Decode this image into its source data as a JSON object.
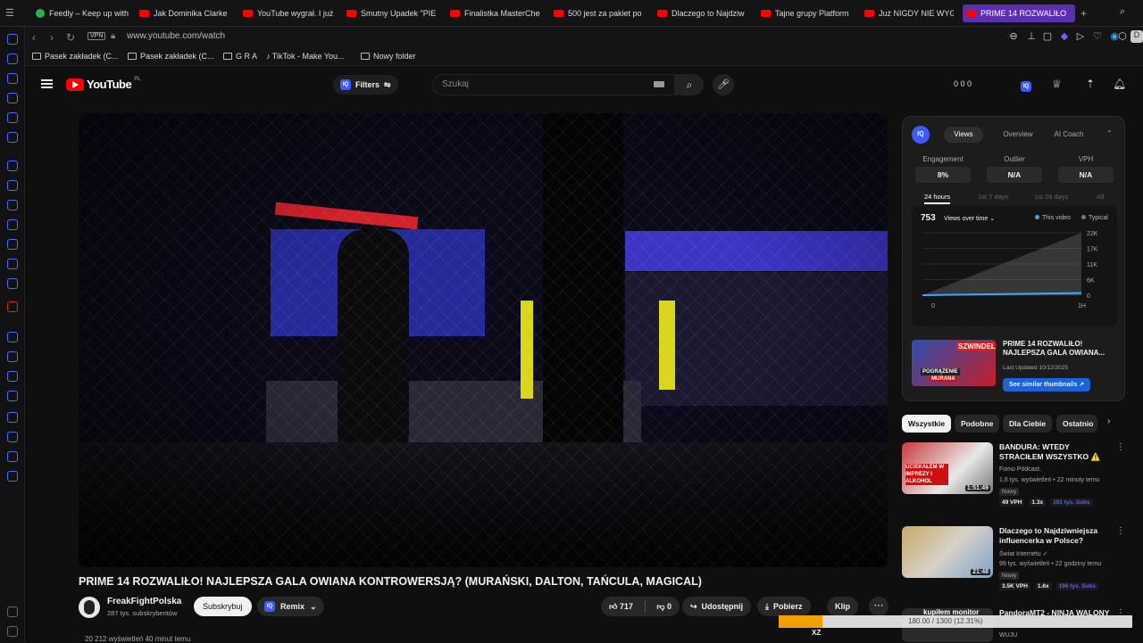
{
  "browser": {
    "tabs": [
      {
        "title": "Feedly – Keep up with",
        "icon": "feedly-icon"
      },
      {
        "title": "Jak Dominika Clarke",
        "icon": "youtube-icon"
      },
      {
        "title": "YouTube wygrał. I już",
        "icon": "youtube-icon"
      },
      {
        "title": "Smutny Upadek \"PIE",
        "icon": "youtube-icon"
      },
      {
        "title": "Finalistka MasterChe",
        "icon": "youtube-icon"
      },
      {
        "title": "500 jest za pakiet po",
        "icon": "youtube-icon"
      },
      {
        "title": "Dlaczego to Najdziw",
        "icon": "youtube-icon"
      },
      {
        "title": "Tajne grupy Platform",
        "icon": "youtube-icon"
      },
      {
        "title": "Już NIGDY NIE WYG",
        "icon": "youtube-icon"
      },
      {
        "title": "PRIME 14 ROZWALIŁO",
        "icon": "youtube-icon",
        "active": true
      }
    ],
    "vpn_label": "VPN",
    "url": "www.youtube.com/watch",
    "bookmarks": [
      "Pasek zakładek (C...",
      "Pasek zakładek (C...",
      "G R A",
      "TikTok - Make You...",
      "Nowy folder"
    ],
    "accent": "#5a2fb0"
  },
  "youtube": {
    "logo_text": "YouTube",
    "logo_country": "PL",
    "filters_label": "Filters",
    "search_placeholder": "Szukaj",
    "header_stats": "0  0  0",
    "video": {
      "title": "PRIME 14 ROZWALIŁO! NAJLEPSZA GALA OWIANA KONTROWERSJĄ? (MURAŃSKI, DALTON, TAŃCULA, MAGICAL)",
      "channel": "FreakFightPolska",
      "subscribers": "287 tys. subskrybentów",
      "subscribe_label": "Subskrybuj",
      "remix_label": "Remix",
      "likes": "717",
      "dislikes": "0",
      "share_label": "Udostępnij",
      "download_label": "Pobierz",
      "clip_label": "Klip",
      "views_line": "20 212 wyświetleń  40 minut temu"
    },
    "iq_panel": {
      "logo": "IQ",
      "tabs": [
        "Views",
        "Overview",
        "AI Coach"
      ],
      "metrics": [
        {
          "label": "Engagement",
          "value": "8%"
        },
        {
          "label": "Outlier",
          "value": "N/A"
        },
        {
          "label": "VPH",
          "value": "N/A"
        }
      ],
      "ranges": [
        "24 hours",
        "1st 7 days",
        "1st 28 days",
        "All"
      ],
      "views_count": "753",
      "views_over_time": "Views over time",
      "legend_this": "This video",
      "legend_typical": "Typical",
      "thumb_text1": "SZWINDEL?",
      "thumb_text2": "POGRĄŻENIE",
      "thumb_text3": "MURANA",
      "video_title": "PRIME 14 ROZWALIŁO! NAJLEPSZA GALA OWIANA...",
      "last_updated": "Last Updated 10/12/2025",
      "similar_label": "See similar thumbnails ↗"
    },
    "chips": [
      "Wszystkie",
      "Podobne",
      "Dla Ciebie",
      "Ostatnio"
    ],
    "recommendations": [
      {
        "title": "BANDURA: WTEDY STRACIŁEM WSZYSTKO ⚠️",
        "channel": "Fomo Pódcast.",
        "views": "1,6 tys. wyświetleń • 22 minuty temu",
        "badge": "Nowy",
        "duration": "1:51:49",
        "vph": "49 VPH",
        "mult": "1.3x",
        "subs": "191 tys. Subs",
        "thumb_text": "UCIEKAŁEM W IMPREZY I ALKOHOL"
      },
      {
        "title": "Dlaczego to Najdziwniejsza influencerka w Polsce?",
        "channel": "Świat Internetu ✓",
        "views": "99 tys. wyświetleń • 22 godziny temu",
        "badge": "Nowy",
        "duration": "21:48",
        "vph": "3.5K VPH",
        "mult": "1.6x",
        "subs": "196 tys. Subs",
        "thumb_text": ""
      },
      {
        "title": "PandoraMT2 - NINJA WALONY",
        "channel": "WUJU",
        "views": "",
        "badge": "",
        "duration": "",
        "vph": "",
        "mult": "",
        "subs": "",
        "thumb_text": "kupiłem monitor"
      }
    ],
    "hover_progress_text": "180.00 / 1300 (12.31%)",
    "hover_progress_value": 0.1231,
    "bottom_tag": "XZ"
  },
  "chart_data": {
    "type": "area",
    "title": "Views over time",
    "x_ticks": [
      "0",
      "1H"
    ],
    "y_ticks": [
      "22K",
      "17K",
      "11K",
      "6K",
      "0"
    ],
    "ylim": [
      0,
      22000
    ],
    "series": [
      {
        "name": "This video",
        "x": [
          0,
          1
        ],
        "values": [
          0,
          753
        ]
      },
      {
        "name": "Typical",
        "x": [
          0,
          1
        ],
        "values": [
          0,
          22000
        ]
      }
    ]
  }
}
